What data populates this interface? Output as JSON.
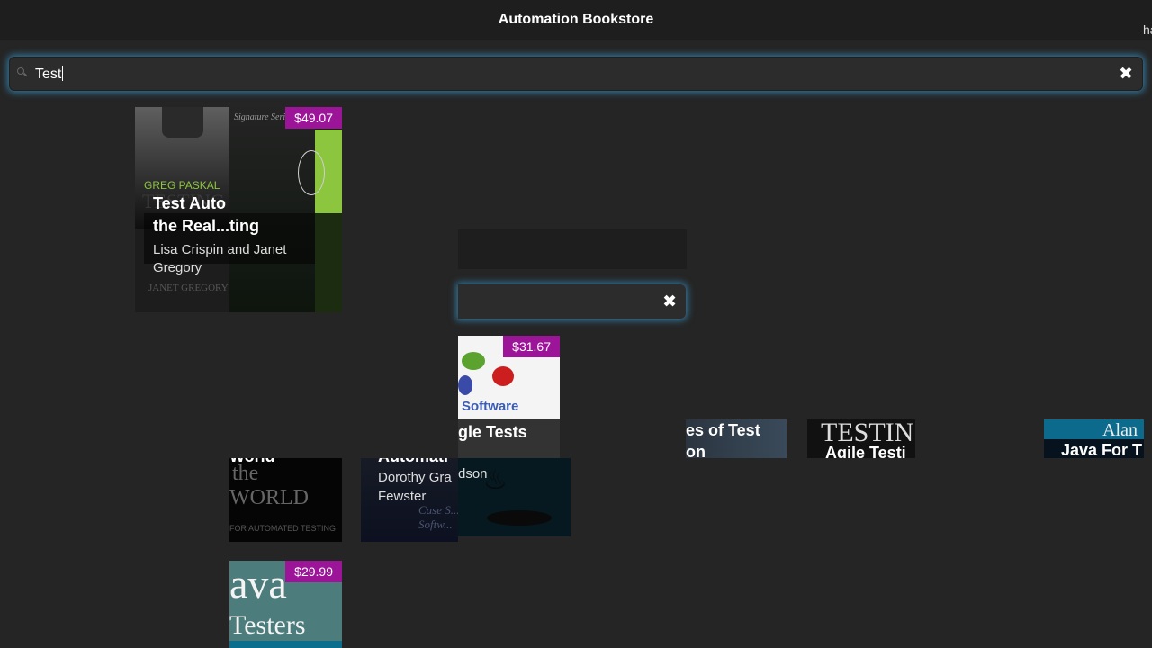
{
  "header": {
    "title": "Automation Bookstore",
    "edge_text": "ha"
  },
  "search": {
    "value": "Test",
    "clear_icon": "close-icon",
    "search_icon": "magnifier-icon"
  },
  "ghost_search": {
    "clear_icon": "close-icon"
  },
  "books": [
    {
      "price": "$49.07",
      "title_line1": "Test Auto",
      "title_line2": "the Real...ting",
      "author_line1": "Lisa Crispin and Janet",
      "author_line2": "Gregory",
      "cover_text": "GREG PASKAL"
    },
    {
      "price": "$31.67",
      "title": "gle Tests",
      "cover_text": "Software"
    },
    {
      "title_line1": "es of Test",
      "title_line2": "on"
    },
    {
      "cover_text": "TESTIN",
      "title": "Agile Testi"
    },
    {
      "cover_text": "Alan",
      "title": "Java For T"
    },
    {
      "title": "World",
      "cover_line1": "the",
      "cover_line2": "WORLD",
      "cover_line3": "FOR AUTOMATED TESTING"
    },
    {
      "title": "Automati",
      "author_line1": "Dorothy Gra",
      "author_line2": "Fewster",
      "cover_text": "Case S... Softw..."
    },
    {
      "author": "dson"
    },
    {
      "price": "$29.99",
      "cover_line1": "ava",
      "cover_line2": "Testers"
    }
  ]
}
